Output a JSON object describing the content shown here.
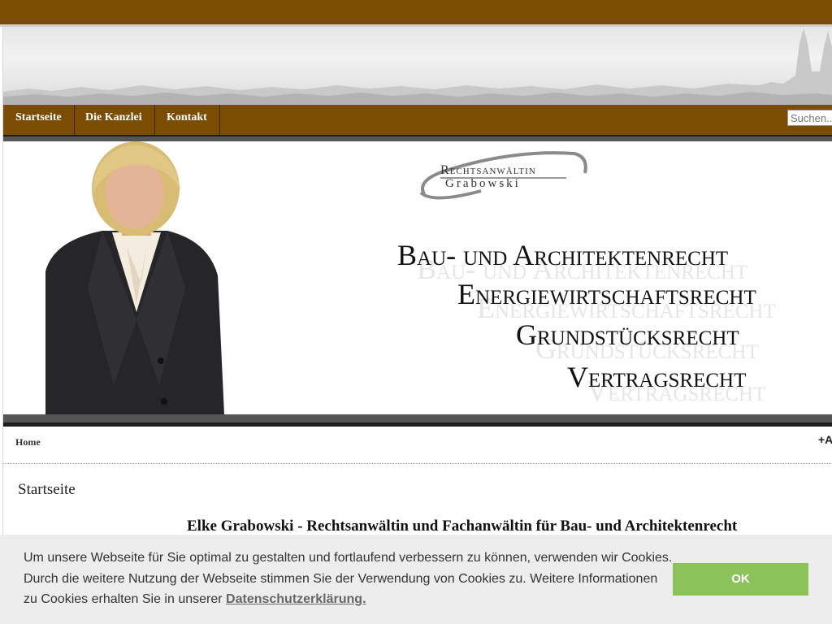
{
  "nav": {
    "items": [
      {
        "label": "Startseite"
      },
      {
        "label": "Die Kanzlei"
      },
      {
        "label": "Kontakt"
      }
    ],
    "search_placeholder": "Suchen..."
  },
  "banner": {
    "logo_line1": "Rechtsanwältin",
    "logo_line2": "Grabowski",
    "areas": [
      "Bau- und Architektenrecht",
      "Energiewirtschaftsrecht",
      "Grundstücksrecht",
      "Vertragsrecht"
    ]
  },
  "breadcrumb": {
    "home": "Home"
  },
  "font_size_icon": "+A",
  "content": {
    "page_title": "Startseite",
    "intro_heading": "Elke Grabowski - Rechtsanwältin und Fachanwältin für Bau- und Architektenrecht"
  },
  "cookie": {
    "text": "Um unsere Webseite für Sie optimal zu gestalten und fortlaufend verbessern zu können, verwenden wir Cookies. Durch die weitere Nutzung der Webseite stimmen Sie der Verwendung von Cookies zu. Weitere Informationen zu Cookies erhalten Sie in unserer",
    "link": "Datenschutzerklärung.",
    "ok_label": "OK"
  },
  "colors": {
    "brand_brown": "#7a4d03",
    "ok_green": "#8cc25a"
  }
}
